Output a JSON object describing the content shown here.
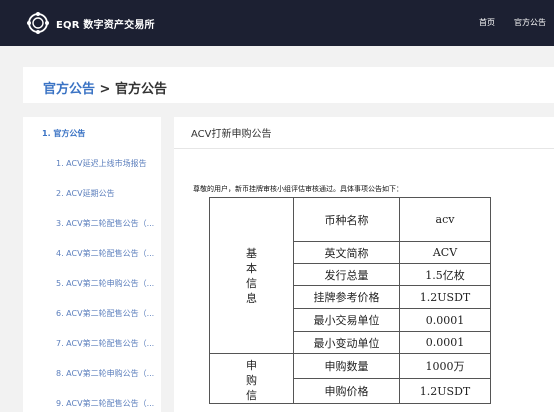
{
  "header": {
    "brand": "EQR 数字资产交易所",
    "nav": [
      "首页",
      "官方公告"
    ]
  },
  "breadcrumb": {
    "parent": "官方公告",
    "separator": " > ",
    "current": "官方公告"
  },
  "sidebar": {
    "items": [
      "1. 官方公告",
      "1. ACV延迟上线市场报告",
      "2. ACV延期公告",
      "3. ACV第二轮配售公告（...",
      "4. ACV第二轮配售公告（...",
      "5. ACV第二轮申购公告（...",
      "6. ACV第二轮配售公告（...",
      "7. ACV第二轮配售公告（...",
      "8. ACV第二轮申购公告（...",
      "9. ACV第二轮配售公告（..."
    ]
  },
  "article": {
    "title": "ACV打新申购公告",
    "intro": "尊敬的用户，新币挂牌审核小组评估审核通过。具体事项公告如下：",
    "groups": [
      {
        "label": "基本信息",
        "rows": [
          [
            "币种名称",
            "acv"
          ],
          [
            "英文简称",
            "ACV"
          ],
          [
            "发行总量",
            "1.5亿枚"
          ],
          [
            "挂牌参考价格",
            "1.2USDT"
          ],
          [
            "最小交易单位",
            "0.0001"
          ],
          [
            "最小变动单位",
            "0.0001"
          ]
        ]
      },
      {
        "label": "申购信",
        "rows": [
          [
            "申购数量",
            "1000万"
          ],
          [
            "申购价格",
            "1.2USDT"
          ]
        ]
      }
    ]
  }
}
